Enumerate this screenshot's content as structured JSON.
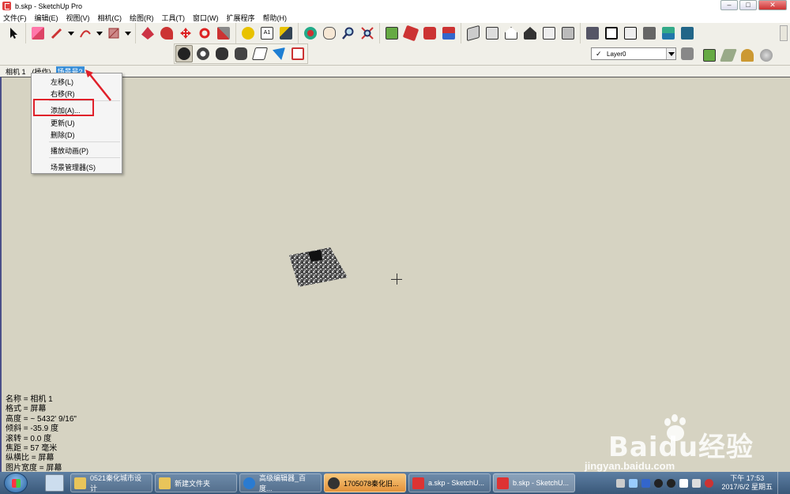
{
  "window": {
    "title": "b.skp - SketchUp Pro",
    "minimize": "–",
    "maximize": "□",
    "close": "✕"
  },
  "menubar": [
    "文件(F)",
    "编辑(E)",
    "视图(V)",
    "相机(C)",
    "绘图(R)",
    "工具(T)",
    "窗口(W)",
    "扩展程序",
    "帮助(H)"
  ],
  "layer": {
    "current": "Layer0",
    "checked": "✓"
  },
  "scenes": {
    "tabs": [
      "相机 1",
      "(操作)",
      "场景号2"
    ],
    "active_index": 2
  },
  "context_menu": {
    "items": [
      "左移(L)",
      "右移(R)",
      "添加(A)...",
      "更新(U)",
      "删除(D)",
      "播放动画(P)",
      "场景管理器(S)"
    ],
    "highlighted": "添加(A)..."
  },
  "camera_info": [
    "名称 = 相机 1",
    "格式 = 屏幕",
    "高度 = ~ 5432' 9/16\"",
    "倾斜 = -35.9 度",
    "滚转 = 0.0 度",
    "焦距 = 57 毫米",
    "纵横比 = 屏幕",
    "图片宽度 = 屏幕"
  ],
  "taskbar": {
    "items": [
      {
        "label": "0521秦化城市设计",
        "icon_color": "#e8c45a"
      },
      {
        "label": "新建文件夹",
        "icon_color": "#e8c45a"
      },
      {
        "label": "高级编辑器_百度...",
        "icon_color": "#2a7bd1"
      },
      {
        "label": "1705078秦化旧...",
        "icon_color": "#f3b04a"
      },
      {
        "label": "a.skp - SketchU...",
        "icon_color": "#d33"
      },
      {
        "label": "b.skp - SketchU...",
        "icon_color": "#d33"
      }
    ],
    "clock_time": "下午 17:53",
    "clock_date": "2017/6/2 星期五"
  },
  "watermark": {
    "text": "Baidu经验",
    "url": "jingyan.baidu.com"
  },
  "colors": {
    "viewport_bg": "#d6d3c2",
    "highlight_box": "#e0202a",
    "active_scene_tab": "#3a8fd8"
  }
}
